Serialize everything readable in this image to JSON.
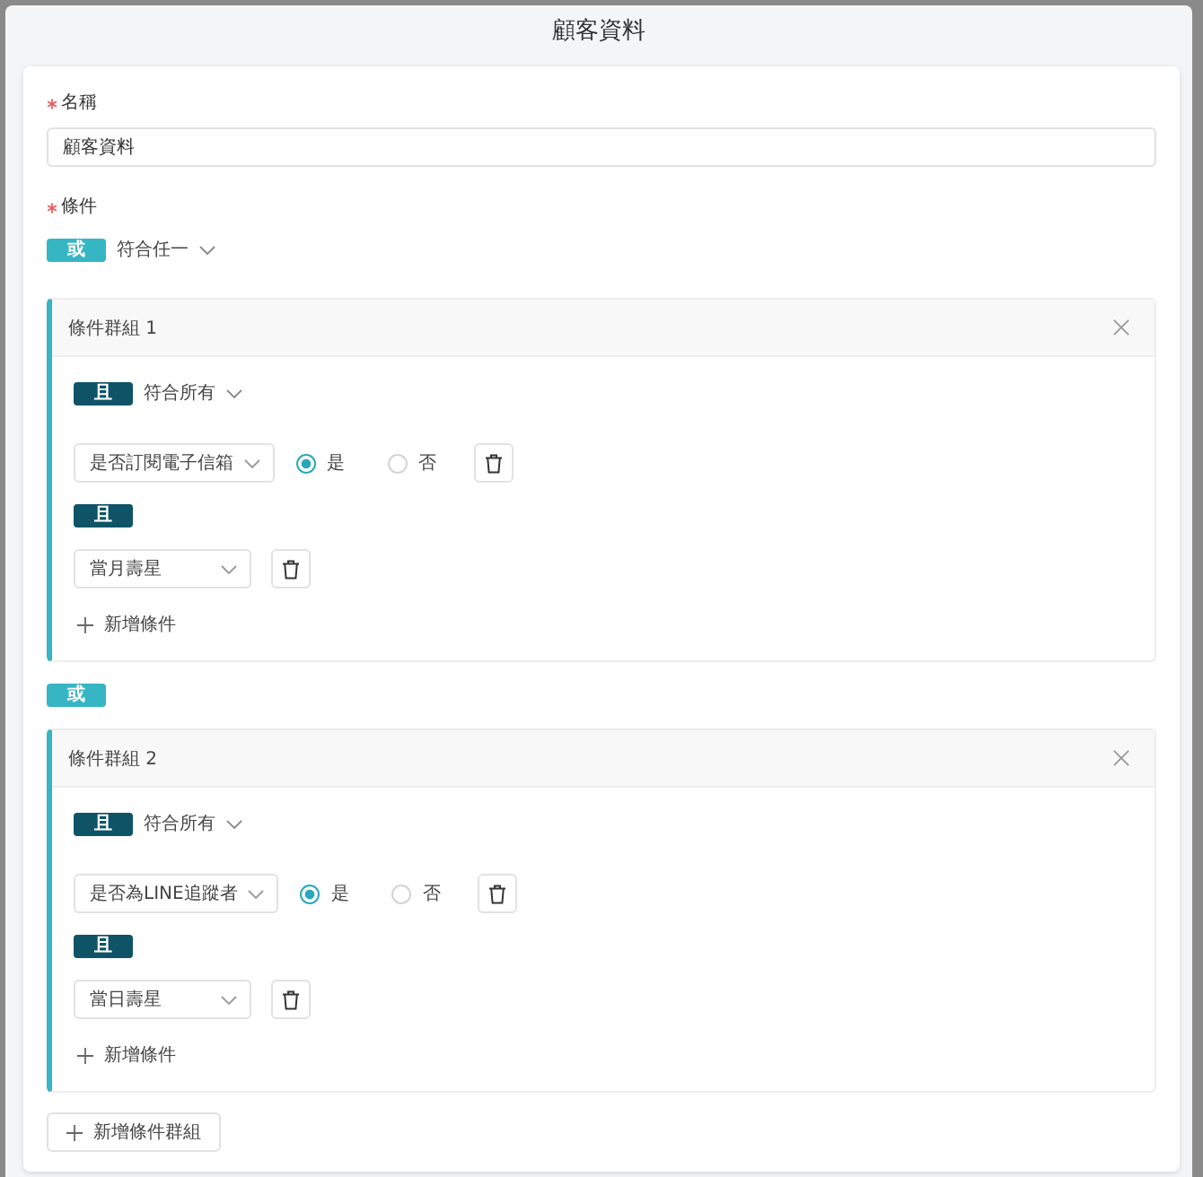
{
  "window": {
    "title": "顧客資料"
  },
  "name_field": {
    "label": "名稱",
    "required": true,
    "value": "顧客資料"
  },
  "conditions": {
    "label": "條件",
    "required": true,
    "logic": {
      "text": "或",
      "kind": "or"
    },
    "match_mode": "符合任一",
    "blocks": [
      {
        "kind": "group",
        "title": "條件群組 1",
        "logic": {
          "text": "且",
          "kind": "and"
        },
        "match_mode": "符合所有",
        "items": [
          {
            "kind": "boolean",
            "field": "是否訂閱電子信箱",
            "options": [
              {
                "label": "是",
                "selected": true
              },
              {
                "label": "否",
                "selected": false
              }
            ]
          },
          {
            "kind": "connector",
            "badge": {
              "text": "且",
              "kind": "and"
            }
          },
          {
            "kind": "select",
            "field": "當月壽星"
          }
        ],
        "add_condition": "新增條件"
      },
      {
        "kind": "connector",
        "badge": {
          "text": "或",
          "kind": "or"
        }
      },
      {
        "kind": "group",
        "title": "條件群組 2",
        "logic": {
          "text": "且",
          "kind": "and"
        },
        "match_mode": "符合所有",
        "items": [
          {
            "kind": "boolean",
            "field": "是否為LINE追蹤者",
            "options": [
              {
                "label": "是",
                "selected": true
              },
              {
                "label": "否",
                "selected": false
              }
            ]
          },
          {
            "kind": "connector",
            "badge": {
              "text": "且",
              "kind": "and"
            }
          },
          {
            "kind": "select",
            "field": "當日壽星"
          }
        ],
        "add_condition": "新增條件"
      }
    ],
    "add_group": "新增條件群組"
  }
}
